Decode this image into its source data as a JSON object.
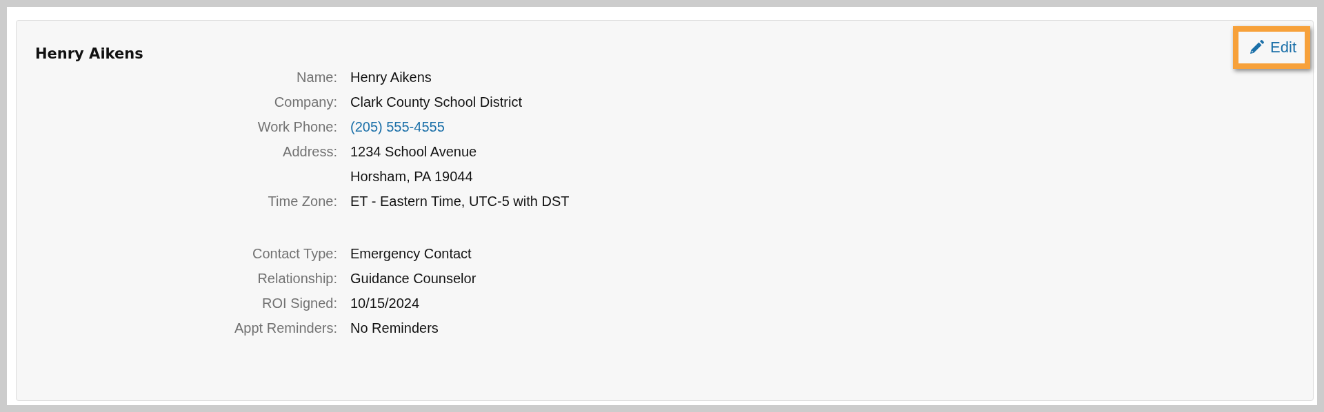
{
  "card": {
    "title": "Henry Aikens",
    "edit_button": {
      "label": "Edit"
    }
  },
  "field_groups": [
    [
      {
        "label": "Name:",
        "kind": "text",
        "lines": [
          "Henry Aikens"
        ]
      },
      {
        "label": "Company:",
        "kind": "text",
        "lines": [
          "Clark County School District"
        ]
      },
      {
        "label": "Work Phone:",
        "kind": "link",
        "lines": [
          "(205) 555-4555"
        ]
      },
      {
        "label": "Address:",
        "kind": "text",
        "lines": [
          "1234 School Avenue",
          "Horsham, PA 19044"
        ]
      },
      {
        "label": "Time Zone:",
        "kind": "text",
        "lines": [
          "ET - Eastern Time, UTC-5 with DST"
        ]
      }
    ],
    [
      {
        "label": "Contact Type:",
        "kind": "text",
        "lines": [
          "Emergency Contact"
        ]
      },
      {
        "label": "Relationship:",
        "kind": "text",
        "lines": [
          "Guidance Counselor"
        ]
      },
      {
        "label": "ROI Signed:",
        "kind": "text",
        "lines": [
          "10/15/2024"
        ]
      },
      {
        "label": "Appt Reminders:",
        "kind": "text",
        "lines": [
          "No Reminders"
        ]
      }
    ]
  ]
}
